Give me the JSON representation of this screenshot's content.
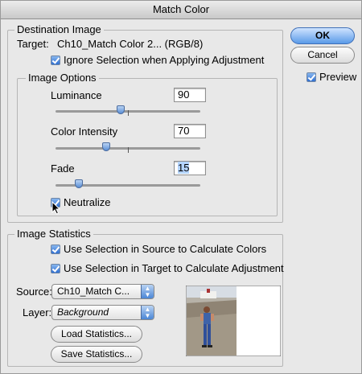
{
  "window": {
    "title": "Match Color"
  },
  "buttons": {
    "ok": "OK",
    "cancel": "Cancel"
  },
  "preview": {
    "label": "Preview",
    "checked": true
  },
  "destination": {
    "legend": "Destination Image",
    "target_label": "Target:",
    "target_value": "Ch10_Match Color 2... (RGB/8)",
    "ignore_selection_label": "Ignore Selection when Applying Adjustment",
    "ignore_selection_checked": true,
    "options": {
      "legend": "Image Options",
      "luminance": {
        "label": "Luminance",
        "value": "90"
      },
      "color_intensity": {
        "label": "Color Intensity",
        "value": "70"
      },
      "fade": {
        "label": "Fade",
        "value": "15"
      },
      "neutralize": {
        "label": "Neutralize",
        "checked": true
      }
    }
  },
  "statistics": {
    "legend": "Image Statistics",
    "use_source_label": "Use Selection in Source to Calculate Colors",
    "use_source_checked": true,
    "use_target_label": "Use Selection in Target to Calculate Adjustment",
    "use_target_checked": true,
    "source_label": "Source:",
    "source_value": "Ch10_Match C...",
    "layer_label": "Layer:",
    "layer_value": "Background",
    "load_button": "Load Statistics...",
    "save_button": "Save Statistics..."
  },
  "colors": {
    "accent": "#2f6fd1",
    "window_bg": "#e8e8e8"
  },
  "icons": [
    "checkmark-icon",
    "popup-arrows-icon",
    "mouse-cursor-icon"
  ]
}
